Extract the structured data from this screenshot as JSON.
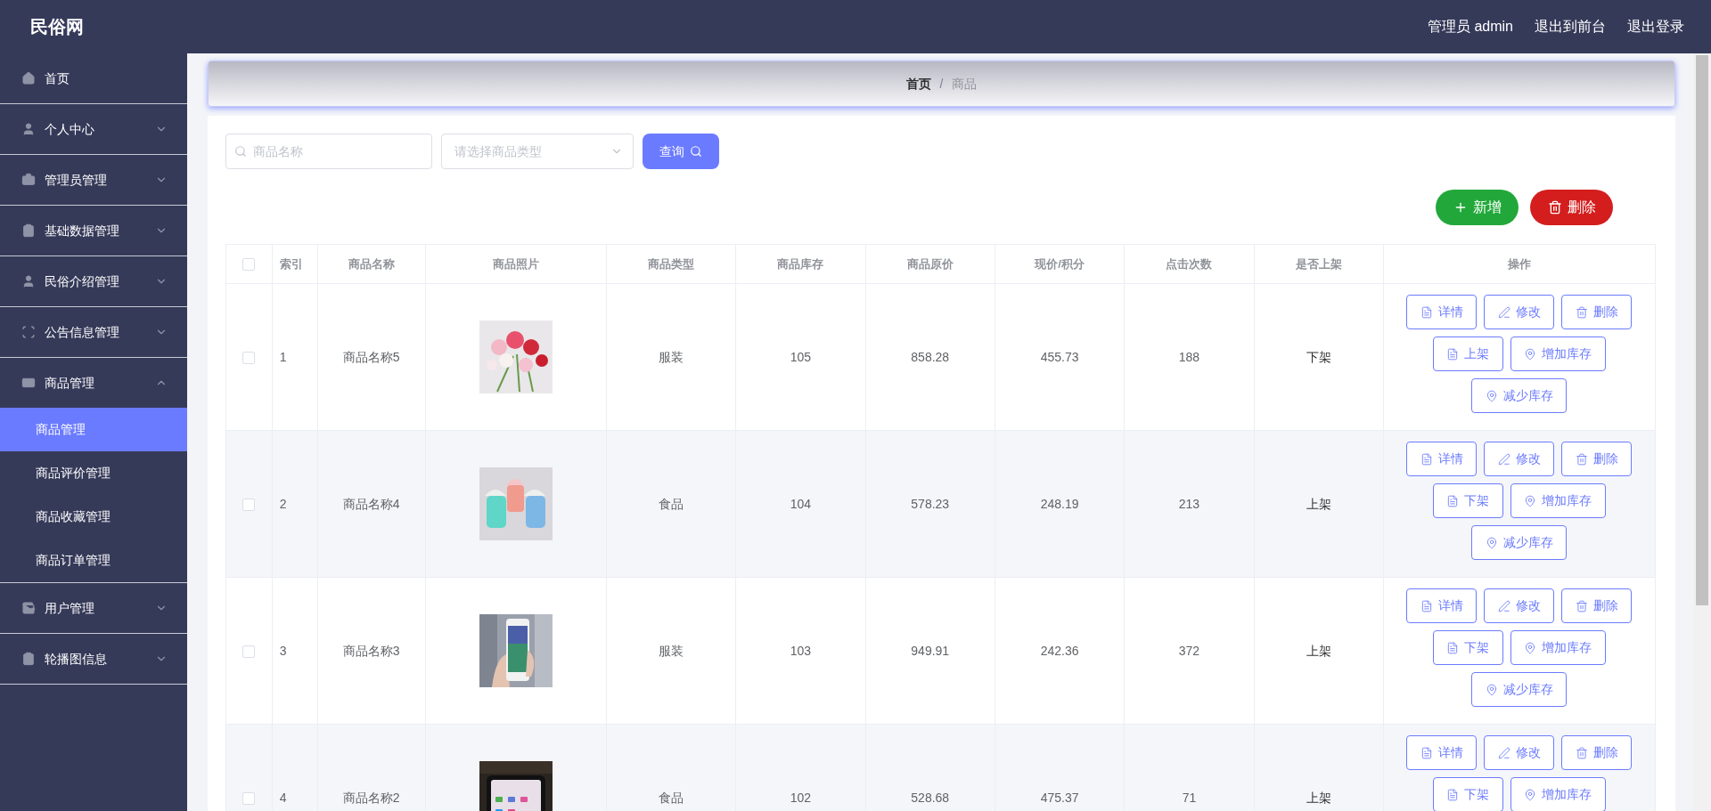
{
  "header": {
    "logo": "民俗网",
    "links": [
      "管理员 admin",
      "退出到前台",
      "退出登录"
    ]
  },
  "sidebar": {
    "items": [
      {
        "label": "首页"
      },
      {
        "label": "个人中心",
        "expanded": false
      },
      {
        "label": "管理员管理",
        "expanded": false
      },
      {
        "label": "基础数据管理",
        "expanded": false
      },
      {
        "label": "民俗介绍管理",
        "expanded": false
      },
      {
        "label": "公告信息管理",
        "expanded": false
      },
      {
        "label": "商品管理",
        "expanded": true,
        "children": [
          {
            "label": "商品管理",
            "selected": true
          },
          {
            "label": "商品评价管理",
            "selected": false
          },
          {
            "label": "商品收藏管理",
            "selected": false
          },
          {
            "label": "商品订单管理",
            "selected": false
          }
        ]
      },
      {
        "label": "用户管理",
        "expanded": false
      },
      {
        "label": "轮播图信息",
        "expanded": false
      }
    ]
  },
  "breadcrumb": [
    "首页",
    "商品"
  ],
  "breadcrumb_separator": "/",
  "search": {
    "name_placeholder": "商品名称",
    "type_placeholder": "请选择商品类型",
    "button": "查询"
  },
  "actions": [
    {
      "kind": "add",
      "label": "新增"
    },
    {
      "kind": "delete",
      "label": "删除"
    }
  ],
  "table": {
    "header_checked": false,
    "columns": [
      "索引",
      "商品名称",
      "商品照片",
      "商品类型",
      "商品库存",
      "商品原价",
      "现价/积分",
      "点击次数",
      "是否上架",
      "操作"
    ],
    "rows": [
      {
        "checked": false,
        "index": "1",
        "name": "商品名称5",
        "type": "服装",
        "stock": "105",
        "price": "858.28",
        "current": "455.73",
        "clicks": "188",
        "status": "下架",
        "buttons": [
          {
            "kind": "detail",
            "label": "详情"
          },
          {
            "kind": "edit",
            "label": "修改"
          },
          {
            "kind": "delete",
            "label": "删除"
          },
          {
            "kind": "shelf",
            "label": "上架"
          },
          {
            "kind": "add_stock",
            "label": "增加库存"
          },
          {
            "kind": "reduce_stock",
            "label": "减少库存"
          }
        ]
      },
      {
        "checked": false,
        "index": "2",
        "name": "商品名称4",
        "type": "食品",
        "stock": "104",
        "price": "578.23",
        "current": "248.19",
        "clicks": "213",
        "status": "上架",
        "buttons": [
          {
            "kind": "detail",
            "label": "详情"
          },
          {
            "kind": "edit",
            "label": "修改"
          },
          {
            "kind": "delete",
            "label": "删除"
          },
          {
            "kind": "shelf",
            "label": "下架"
          },
          {
            "kind": "add_stock",
            "label": "增加库存"
          },
          {
            "kind": "reduce_stock",
            "label": "减少库存"
          }
        ]
      },
      {
        "checked": false,
        "index": "3",
        "name": "商品名称3",
        "type": "服装",
        "stock": "103",
        "price": "949.91",
        "current": "242.36",
        "clicks": "372",
        "status": "上架",
        "buttons": [
          {
            "kind": "detail",
            "label": "详情"
          },
          {
            "kind": "edit",
            "label": "修改"
          },
          {
            "kind": "delete",
            "label": "删除"
          },
          {
            "kind": "shelf",
            "label": "下架"
          },
          {
            "kind": "add_stock",
            "label": "增加库存"
          },
          {
            "kind": "reduce_stock",
            "label": "减少库存"
          }
        ]
      },
      {
        "checked": false,
        "index": "4",
        "name": "商品名称2",
        "type": "食品",
        "stock": "102",
        "price": "528.68",
        "current": "475.37",
        "clicks": "71",
        "status": "上架",
        "buttons": [
          {
            "kind": "detail",
            "label": "详情"
          },
          {
            "kind": "edit",
            "label": "修改"
          },
          {
            "kind": "delete",
            "label": "删除"
          },
          {
            "kind": "shelf",
            "label": "下架"
          },
          {
            "kind": "add_stock",
            "label": "增加库存"
          }
        ]
      }
    ]
  }
}
